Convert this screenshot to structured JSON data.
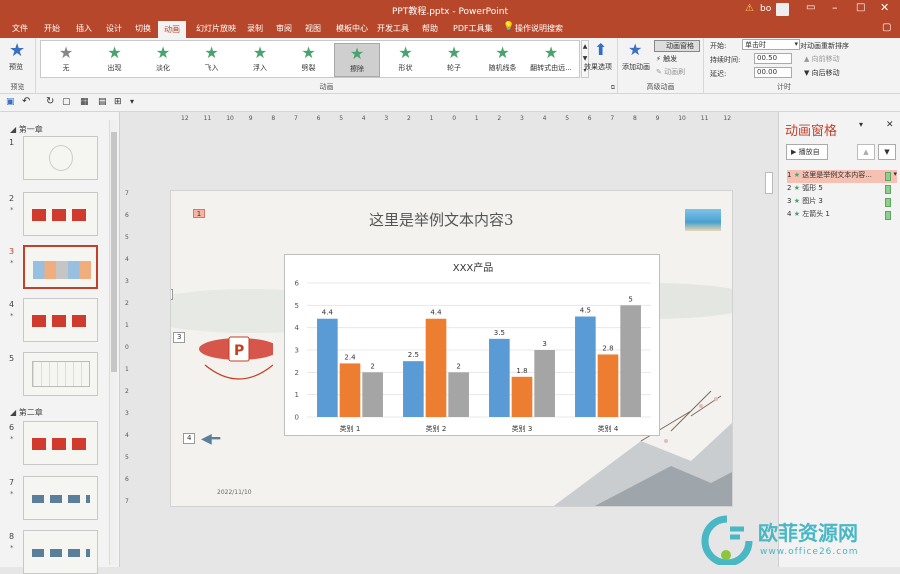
{
  "window": {
    "title": "PPT教程.pptx  -  PowerPoint",
    "user": "bo"
  },
  "tabs": [
    "文件",
    "开始",
    "插入",
    "设计",
    "切换",
    "动画",
    "幻灯片放映",
    "录制",
    "审阅",
    "视图",
    "模板中心",
    "开发工具",
    "帮助",
    "PDF工具集",
    "操作说明搜索"
  ],
  "active_tab": "动画",
  "ribbon": {
    "preview": {
      "label": "预览",
      "group": "预览"
    },
    "animations": [
      {
        "label": "无",
        "style": "gray"
      },
      {
        "label": "出现",
        "style": "green"
      },
      {
        "label": "淡化",
        "style": "green"
      },
      {
        "label": "飞入",
        "style": "green"
      },
      {
        "label": "浮入",
        "style": "green"
      },
      {
        "label": "劈裂",
        "style": "green"
      },
      {
        "label": "擦除",
        "style": "green"
      },
      {
        "label": "形状",
        "style": "green"
      },
      {
        "label": "轮子",
        "style": "green"
      },
      {
        "label": "随机线条",
        "style": "green"
      },
      {
        "label": "翻转式由远...",
        "style": "green"
      }
    ],
    "selected_animation": "擦除",
    "effect_options": "效果选项",
    "animation_group": "动画",
    "add_animation": "添加动画",
    "animation_pane": "动画窗格",
    "trigger": "触发",
    "painter": "动画刷",
    "advanced_group": "高级动画",
    "start_label": "开始:",
    "start_value": "单击时",
    "duration_label": "持续时间:",
    "duration_value": "00.50",
    "delay_label": "延迟:",
    "delay_value": "00.00",
    "reorder": "对动画重新排序",
    "move_earlier": "向前移动",
    "move_later": "向后移动",
    "timing_group": "计时"
  },
  "slides_panel": {
    "sections": [
      "第一章",
      "第二章"
    ],
    "slides": [
      {
        "num": "1",
        "star": ""
      },
      {
        "num": "2",
        "star": "*"
      },
      {
        "num": "3",
        "star": "*"
      },
      {
        "num": "4",
        "star": "*"
      },
      {
        "num": "5",
        "star": ""
      },
      {
        "num": "6",
        "star": "*"
      },
      {
        "num": "7",
        "star": "*"
      },
      {
        "num": "8",
        "star": "*"
      }
    ],
    "selected": "3"
  },
  "ruler": {
    "h": [
      "12",
      "11",
      "10",
      "9",
      "8",
      "7",
      "6",
      "5",
      "4",
      "3",
      "2",
      "1",
      "0",
      "1",
      "2",
      "3",
      "4",
      "5",
      "6",
      "7",
      "8",
      "9",
      "10",
      "11",
      "12"
    ],
    "v": [
      "7",
      "6",
      "5",
      "4",
      "3",
      "2",
      "1",
      "0",
      "1",
      "2",
      "3",
      "4",
      "5",
      "6",
      "7"
    ]
  },
  "slide": {
    "title": "这里是举例文本内容3",
    "date": "2022/11/10",
    "tags": [
      "1",
      "2",
      "3",
      "4"
    ]
  },
  "chart_data": {
    "type": "bar",
    "title": "XXX产品",
    "categories": [
      "类别 1",
      "类别 2",
      "类别 3",
      "类别 4"
    ],
    "series": [
      {
        "values": [
          4.4,
          2.5,
          3.5,
          4.5
        ],
        "color": "#5b9bd5"
      },
      {
        "values": [
          2.4,
          4.4,
          1.8,
          2.8
        ],
        "color": "#ed7d31"
      },
      {
        "values": [
          2,
          2,
          3,
          5
        ],
        "color": "#a5a5a5"
      }
    ],
    "ylim": [
      0,
      6
    ],
    "yticks": [
      "0",
      "1",
      "2",
      "3",
      "4",
      "5",
      "6"
    ],
    "grid": true
  },
  "anim_pane": {
    "title": "动画窗格",
    "play": "播放自",
    "items": [
      {
        "num": "1",
        "label": "这里是举例文本内容..."
      },
      {
        "num": "2",
        "label": "弧形 5"
      },
      {
        "num": "3",
        "label": "图片 3"
      },
      {
        "num": "4",
        "label": "左箭头 1"
      }
    ]
  },
  "watermark": {
    "brand": "欧菲资源网",
    "url": "www.office26.com"
  }
}
